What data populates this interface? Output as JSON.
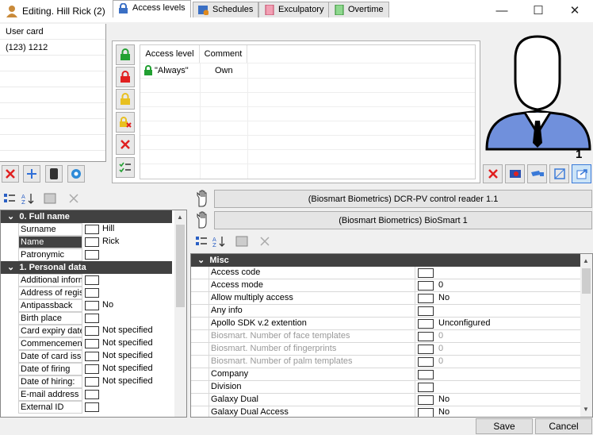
{
  "window": {
    "title": "Editing. Hill Rick (2)",
    "minimize": "—",
    "maximize": "☐",
    "close": "✕"
  },
  "card_list": {
    "items": [
      "User card",
      "(123) 1212"
    ]
  },
  "tabs": [
    {
      "label": "Access levels",
      "icon": "lock-icon"
    },
    {
      "label": "Schedules",
      "icon": "calendar-clock-icon"
    },
    {
      "label": "Exculpatory",
      "icon": "pink-document-icon"
    },
    {
      "label": "Overtime",
      "icon": "green-document-icon"
    }
  ],
  "access_table": {
    "columns": [
      "Access level",
      "Comment"
    ],
    "rows": [
      {
        "level": "\"Always\"",
        "comment": "Own"
      }
    ]
  },
  "photo": {
    "count": "1"
  },
  "left_props": {
    "sections": [
      {
        "title": "0. Full name",
        "rows": [
          {
            "name": "Surname",
            "value": "Hill"
          },
          {
            "name": "Name",
            "value": "Rick",
            "selected": true
          },
          {
            "name": "Patronymic",
            "value": ""
          }
        ]
      },
      {
        "title": "1. Personal data",
        "rows": [
          {
            "name": "Additional inform",
            "value": ""
          },
          {
            "name": "Address of regist",
            "value": ""
          },
          {
            "name": "Antipassback",
            "value": "No"
          },
          {
            "name": "Birth place",
            "value": ""
          },
          {
            "name": "Card expiry date",
            "value": "Not specified"
          },
          {
            "name": "Commencement",
            "value": "Not specified"
          },
          {
            "name": "Date of card issu",
            "value": "Not specified"
          },
          {
            "name": "Date of firing",
            "value": "Not specified"
          },
          {
            "name": "Date of hiring:",
            "value": "Not specified"
          },
          {
            "name": "E-mail address",
            "value": ""
          },
          {
            "name": "External ID",
            "value": ""
          }
        ]
      }
    ]
  },
  "devices": [
    "(Biosmart Biometrics) DCR-PV control reader 1.1",
    "(Biosmart Biometrics) BioSmart 1"
  ],
  "right_props": {
    "section": "Misc",
    "rows": [
      {
        "name": "Access code",
        "value": "",
        "disabled": false
      },
      {
        "name": "Access mode",
        "value": "0",
        "disabled": false
      },
      {
        "name": "Allow multiply access",
        "value": "No",
        "disabled": false
      },
      {
        "name": "Any info",
        "value": "",
        "disabled": false
      },
      {
        "name": "Apollo SDK v.2 extention",
        "value": "Unconfigured",
        "disabled": false
      },
      {
        "name": "Biosmart. Number of face templates",
        "value": "0",
        "disabled": true
      },
      {
        "name": "Biosmart. Number of fingerprints",
        "value": "0",
        "disabled": true
      },
      {
        "name": "Biosmart. Number of palm templates",
        "value": "0",
        "disabled": true
      },
      {
        "name": "Company",
        "value": "",
        "disabled": false
      },
      {
        "name": "Division",
        "value": "",
        "disabled": false
      },
      {
        "name": "Galaxy Dual",
        "value": "No",
        "disabled": false
      },
      {
        "name": "Galaxy Dual Access",
        "value": "No",
        "disabled": false
      }
    ]
  },
  "buttons": {
    "save": "Save",
    "cancel": "Cancel"
  },
  "colors": {
    "section_bg": "#414141",
    "avatar_blue": "#6f8ad8",
    "red": "#e02020"
  }
}
